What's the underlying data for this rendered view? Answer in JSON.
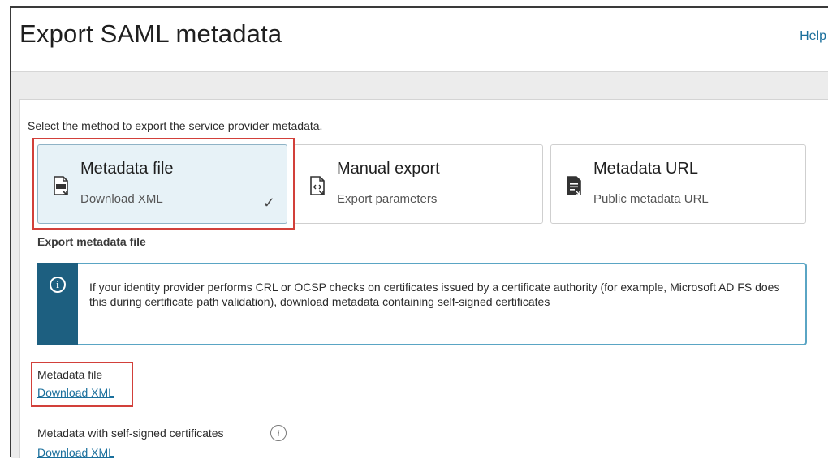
{
  "header": {
    "title": "Export SAML metadata",
    "help_label": "Help"
  },
  "instruction": "Select the method to export the service provider metadata.",
  "methods": [
    {
      "title": "Metadata file",
      "subtitle": "Download XML",
      "icon": "xml-file-icon",
      "selected": true
    },
    {
      "title": "Manual export",
      "subtitle": "Export parameters",
      "icon": "code-file-icon",
      "selected": false
    },
    {
      "title": "Metadata URL",
      "subtitle": "Public metadata URL",
      "icon": "document-link-icon",
      "selected": false
    }
  ],
  "section_title": "Export metadata file",
  "info_message": "If your identity provider performs CRL or OCSP checks on certificates issued by a certificate authority (for example, Microsoft AD FS does this during certificate path validation), download metadata containing self-signed certificates",
  "fields": [
    {
      "label": "Metadata file",
      "link": "Download XML"
    },
    {
      "label": "Metadata with self-signed certificates",
      "link": "Download XML"
    }
  ],
  "colors": {
    "accent": "#1d5f80",
    "link": "#1a6f9c",
    "highlight": "#d2403a",
    "selected_bg": "#e7f2f7"
  }
}
